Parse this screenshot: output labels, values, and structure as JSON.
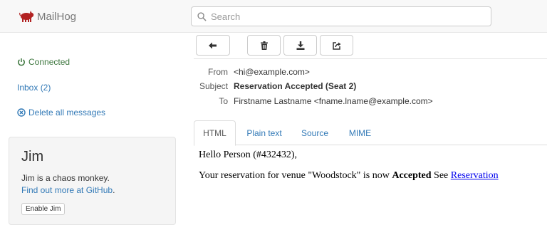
{
  "brand": {
    "name": "MailHog",
    "logo_icon": "pig-icon",
    "logo_color": "#b22222"
  },
  "search": {
    "placeholder": "Search",
    "value": ""
  },
  "sidebar": {
    "connected": "Connected",
    "inbox": "Inbox (2)",
    "delete_all": "Delete all messages",
    "connected_color": "#3c763d",
    "link_color": "#337ab7"
  },
  "jim": {
    "title": "Jim",
    "desc": "Jim is a chaos monkey.",
    "link": "Find out more at GitHub",
    "link_suffix": ".",
    "button": "Enable Jim"
  },
  "toolbar": {
    "back_icon": "arrow-left-icon",
    "delete_icon": "trash-icon",
    "download_icon": "download-icon",
    "release_icon": "share-icon"
  },
  "message": {
    "from_label": "From",
    "from": "<hi@example.com>",
    "subject_label": "Subject",
    "subject": "Reservation Accepted (Seat 2)",
    "to_label": "To",
    "to": "Firstname Lastname <fname.lname@example.com>"
  },
  "tabs": [
    {
      "label": "HTML",
      "active": true
    },
    {
      "label": "Plain text",
      "active": false
    },
    {
      "label": "Source",
      "active": false
    },
    {
      "label": "MIME",
      "active": false
    }
  ],
  "body": {
    "greeting": "Hello Person (#432432),",
    "line_pre": "Your reservation for venue \"Woodstock\" is now ",
    "line_bold": "Accepted",
    "line_mid": " See ",
    "line_link": "Reservation"
  }
}
